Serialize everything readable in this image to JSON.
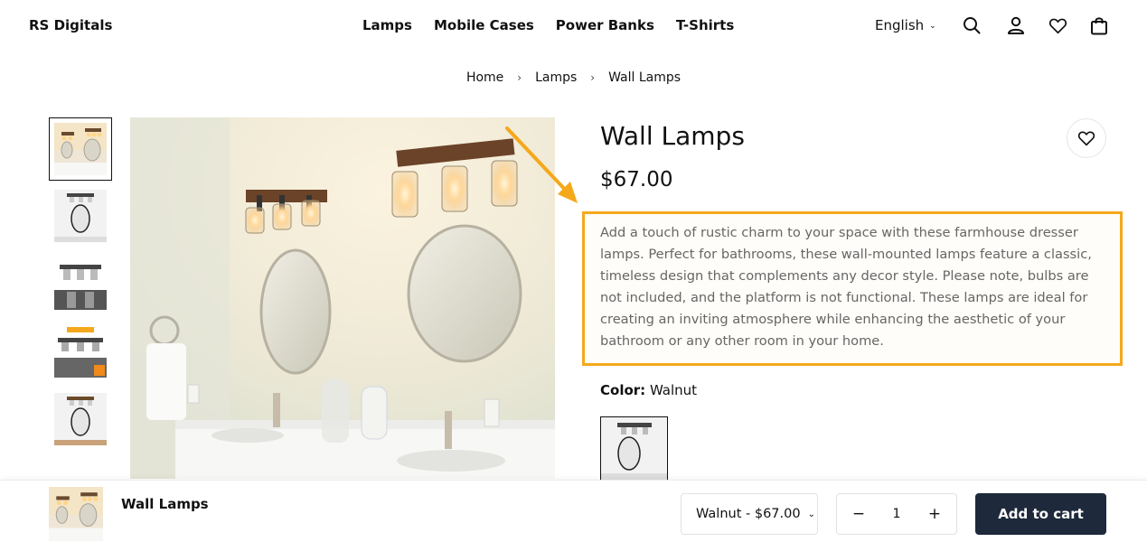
{
  "header": {
    "brand": "RS Digitals",
    "nav": [
      "Lamps",
      "Mobile Cases",
      "Power Banks",
      "T-Shirts"
    ],
    "language": "English",
    "icons": [
      "search-icon",
      "account-icon",
      "wishlist-icon",
      "cart-icon"
    ]
  },
  "breadcrumb": [
    "Home",
    "Lamps",
    "Wall Lamps"
  ],
  "product": {
    "title": "Wall Lamps",
    "price": "$67.00",
    "description": "Add a touch of rustic charm to your space with these farmhouse dresser lamps. Perfect for bathrooms, these wall-mounted lamps feature a classic, timeless design that complements any decor style. Please note, bulbs are not included, and the platform is not functional. These lamps are ideal for creating an inviting atmosphere while enhancing the aesthetic of your bathroom or any other room in your home.",
    "color_label": "Color:",
    "color_value": "Walnut"
  },
  "sticky_bar": {
    "title": "Wall Lamps",
    "variant": "Walnut - $67.00",
    "quantity": "1",
    "add_to_cart": "Add to cart"
  },
  "colors": {
    "highlight": "#f5a81a",
    "button": "#1e293b"
  }
}
